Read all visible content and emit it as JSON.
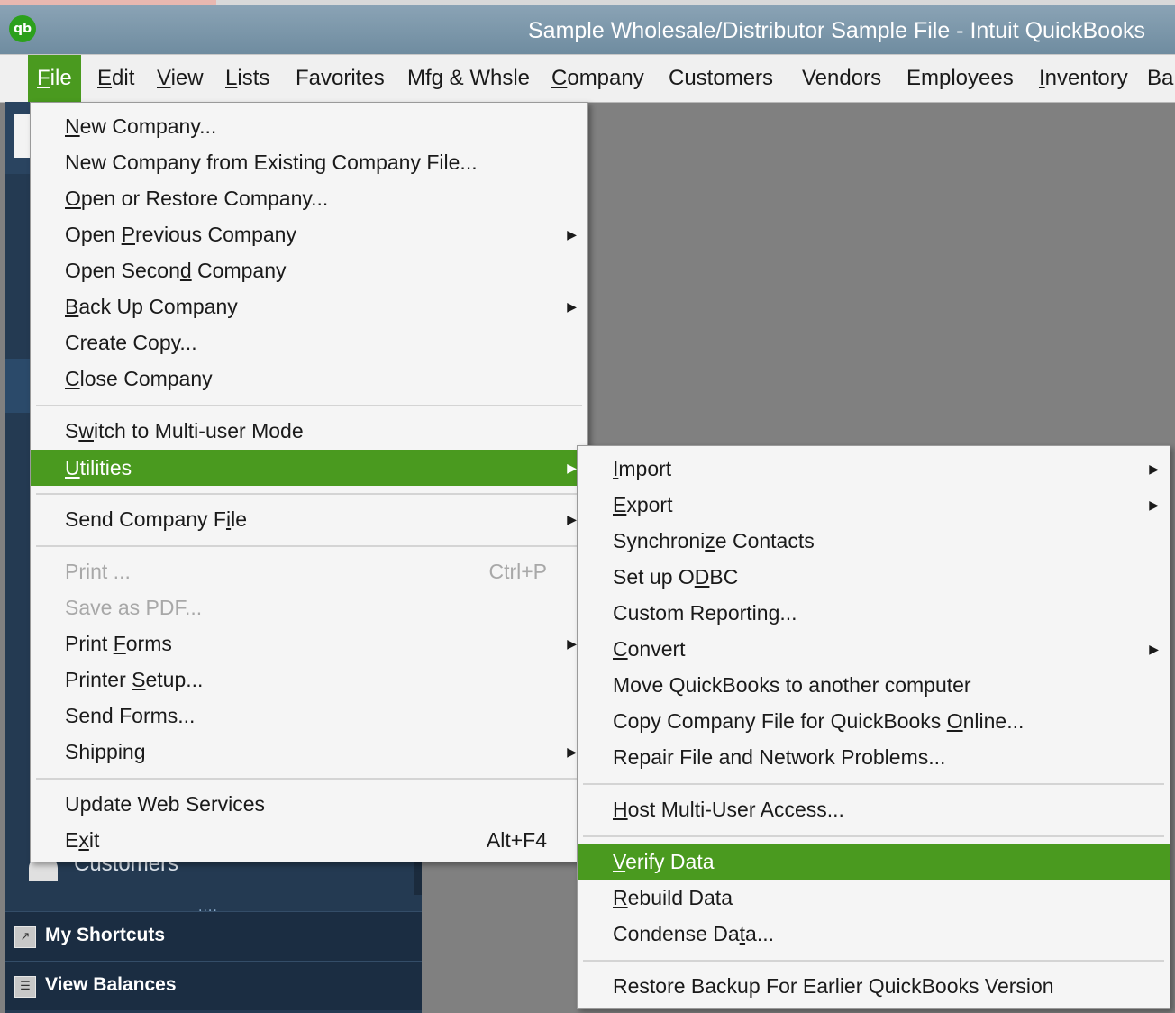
{
  "window": {
    "title": "Sample Wholesale/Distributor Sample File  - Intuit QuickBooks",
    "logo_text": "qb"
  },
  "menubar": {
    "items": [
      {
        "label": "File",
        "ul": "F",
        "rest": "ile",
        "active": true
      },
      {
        "label": "Edit",
        "ul": "E",
        "rest": "dit"
      },
      {
        "label": "View",
        "ul": "V",
        "rest": "iew"
      },
      {
        "label": "Lists",
        "ul": "L",
        "rest": "ists"
      },
      {
        "label": "Favorites"
      },
      {
        "label": "Mfg & Whsle"
      },
      {
        "label": "Company",
        "ul": "C",
        "rest": "ompany"
      },
      {
        "label": "Customers"
      },
      {
        "label": "Vendors"
      },
      {
        "label": "Employees"
      },
      {
        "label": "Inventory",
        "ul": "I",
        "rest": "nventory"
      },
      {
        "label": "Ba"
      }
    ]
  },
  "file_menu": {
    "items": [
      {
        "pre": "",
        "ul": "N",
        "post": "ew Company..."
      },
      {
        "pre": "New Company from Existing Company File...",
        "ul": "",
        "post": ""
      },
      {
        "pre": "",
        "ul": "O",
        "post": "pen or Restore Company..."
      },
      {
        "pre": "Open ",
        "ul": "P",
        "post": "revious Company",
        "submenu": true
      },
      {
        "pre": "Open Secon",
        "ul": "d",
        "post": " Company"
      },
      {
        "pre": "",
        "ul": "B",
        "post": "ack Up Company",
        "submenu": true
      },
      {
        "pre": "Create Copy...",
        "ul": "",
        "post": ""
      },
      {
        "pre": "",
        "ul": "C",
        "post": "lose Company"
      },
      {
        "pre": "S",
        "ul": "w",
        "post": "itch to Multi-user Mode"
      },
      {
        "pre": "",
        "ul": "U",
        "post": "tilities",
        "submenu": true,
        "highlighted": true
      },
      {
        "pre": "Send Company F",
        "ul": "i",
        "post": "le",
        "submenu": true
      },
      {
        "pre": "Print ...",
        "ul": "",
        "post": "",
        "shortcut": "Ctrl+P",
        "disabled": true
      },
      {
        "pre": "Save as PDF...",
        "ul": "",
        "post": "",
        "disabled": true
      },
      {
        "pre": "Print ",
        "ul": "F",
        "post": "orms",
        "submenu": true
      },
      {
        "pre": "Printer ",
        "ul": "S",
        "post": "etup..."
      },
      {
        "pre": "Send Forms...",
        "ul": "",
        "post": ""
      },
      {
        "pre": "Shippin",
        "ul": "g",
        "post": "",
        "submenu": true
      },
      {
        "pre": "Update Web Services",
        "ul": "",
        "post": ""
      },
      {
        "pre": "E",
        "ul": "x",
        "post": "it",
        "shortcut": "Alt+F4"
      }
    ]
  },
  "utilities_menu": {
    "items": [
      {
        "pre": "",
        "ul": "I",
        "post": "mport",
        "submenu": true
      },
      {
        "pre": "",
        "ul": "E",
        "post": "xport",
        "submenu": true
      },
      {
        "pre": "Synchroni",
        "ul": "z",
        "post": "e Contacts"
      },
      {
        "pre": "Set up O",
        "ul": "D",
        "post": "BC"
      },
      {
        "pre": "Custom Reporting...",
        "ul": "",
        "post": ""
      },
      {
        "pre": "",
        "ul": "C",
        "post": "onvert",
        "submenu": true
      },
      {
        "pre": "Move QuickBooks to another computer",
        "ul": "",
        "post": ""
      },
      {
        "pre": "Copy Company File for QuickBooks ",
        "ul": "O",
        "post": "nline..."
      },
      {
        "pre": "Repair File and Network Problems...",
        "ul": "",
        "post": ""
      },
      {
        "pre": "",
        "ul": "H",
        "post": "ost Multi-User Access..."
      },
      {
        "pre": "",
        "ul": "V",
        "post": "erify Data",
        "highlighted": true
      },
      {
        "pre": "",
        "ul": "R",
        "post": "ebuild Data"
      },
      {
        "pre": "Condense Da",
        "ul": "t",
        "post": "a..."
      },
      {
        "pre": "Restore Backup For Earlier QuickBooks Version",
        "ul": "",
        "post": ""
      }
    ]
  },
  "left_nav": {
    "customers_label": "Customers",
    "grip": "....",
    "my_shortcuts": "My Shortcuts",
    "view_balances": "View Balances"
  },
  "colors": {
    "highlight": "#4a9a1f",
    "title_bar": "#7a95a8",
    "nav_dark": "#1b2d42"
  }
}
